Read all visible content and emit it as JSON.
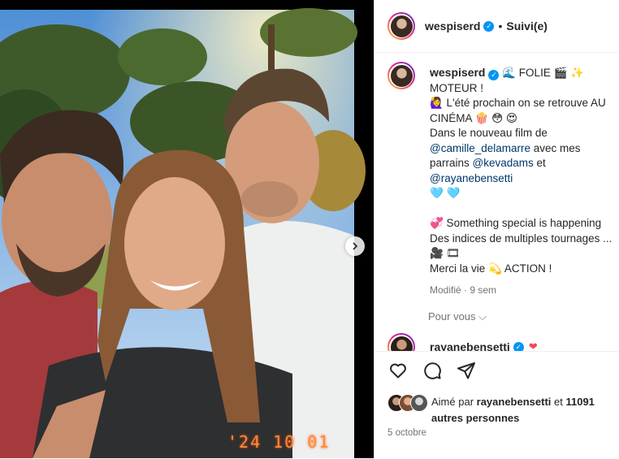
{
  "header": {
    "username": "wespiserd",
    "follow_state": "Suivi(e)",
    "separator": "•"
  },
  "caption": {
    "username": "wespiserd",
    "lines": [
      "🌊 FOLIE 🎬 ✨",
      "MOTEUR !",
      "🙋‍♀️ L'été prochain on se retrouve AU",
      "CINÉMA 🍿 😳 😍",
      "Dans le nouveau film de"
    ],
    "mention_1": "@camille_delamarre",
    "mention_1_suffix": " avec mes",
    "line_parrains_prefix": "parrains ",
    "mention_2": "@kevadams",
    "mention_2_suffix": " et",
    "mention_3": "@rayanebensetti",
    "hearts": "🩵 🩵",
    "line_special": "💞 Something special is happening",
    "line_indices": "Des indices de multiples tournages ...",
    "line_emojis": "🎥 🎞",
    "line_merci": "Merci la vie 💫 ACTION !",
    "modified": "Modifié · 9 sem"
  },
  "pour_vous": "Pour vous ⌵",
  "comment": {
    "username": "rayanebensetti",
    "heart": "❤"
  },
  "actions": {
    "like_icon": "heart-icon",
    "comment_icon": "comment-icon",
    "share_icon": "send-icon"
  },
  "likes": {
    "prefix": "Aimé par ",
    "user": "rayanebensetti",
    "middle": " et ",
    "count": "11091",
    "suffix": " autres personnes"
  },
  "post_date": "5 octobre",
  "photo": {
    "date_stamp": "'24 10 01"
  },
  "colors": {
    "link": "#00376b",
    "verified": "#0095f6",
    "muted": "#737373",
    "heart_red": "#ed4956"
  }
}
